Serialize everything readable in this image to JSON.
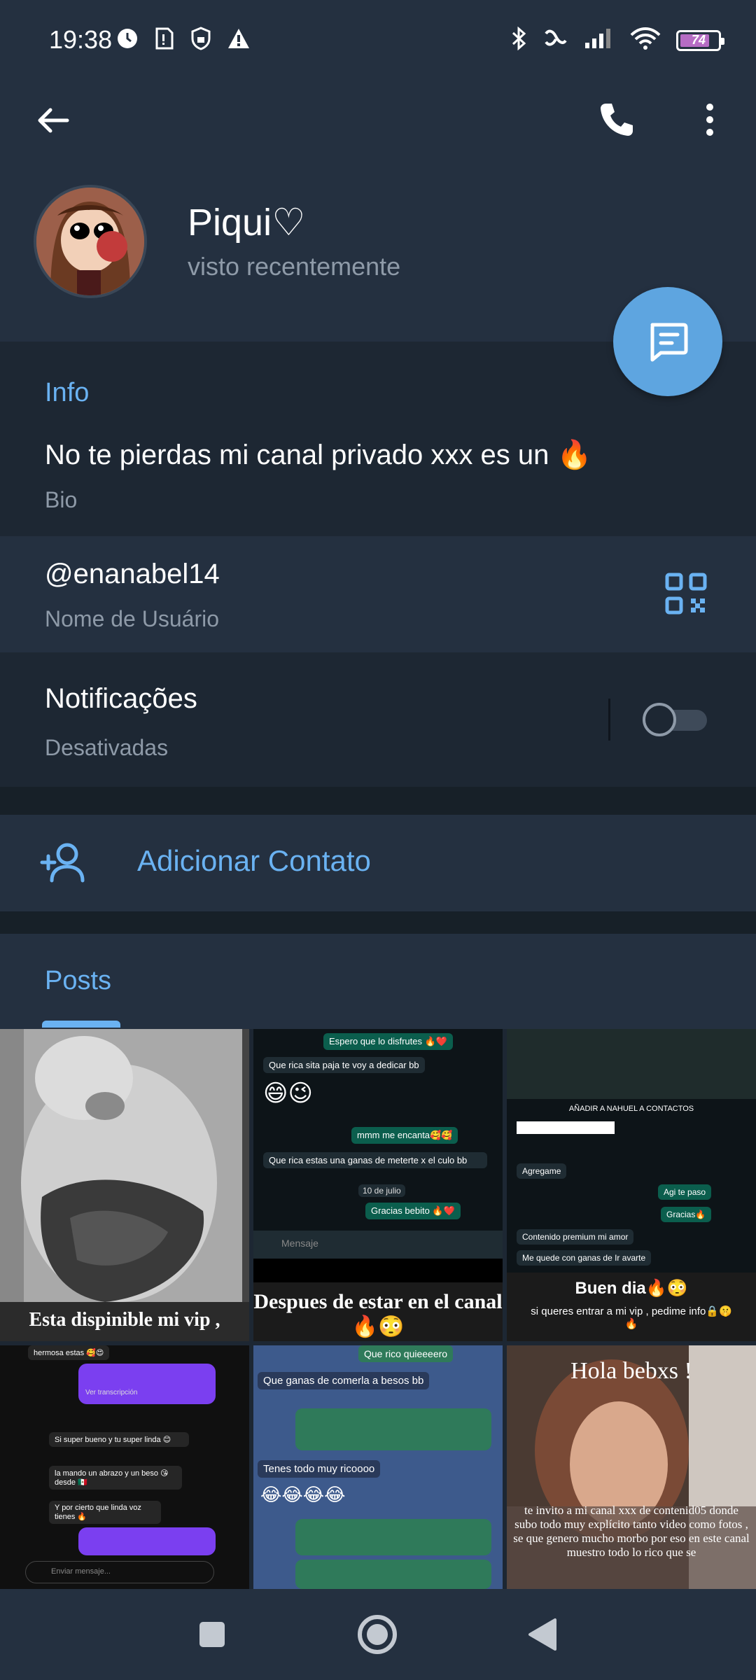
{
  "status_bar": {
    "time": "19:38",
    "battery": "74",
    "icons_left": [
      "clock-icon",
      "sim-icon",
      "vpn-icon",
      "warning-icon"
    ],
    "icons_right": [
      "bluetooth-icon",
      "link-icon",
      "signal-icon",
      "wifi-icon",
      "battery-icon"
    ]
  },
  "header": {
    "name": "Piqui♡",
    "status": "visto recentemente"
  },
  "info": {
    "section_title": "Info",
    "bio": "No te pierdas mi canal privado xxx es un 🔥",
    "bio_label": "Bio",
    "username": "@enanabel14",
    "username_label": "Nome de Usuário",
    "notifications": "Notificações",
    "notifications_state": "Desativadas"
  },
  "actions": {
    "add_contact": "Adicionar Contato"
  },
  "posts": {
    "tab_label": "Posts",
    "tile1_caption": "Esta dispinible mi vip ,",
    "tile2_caption": "Despues de estar en el canal 🔥😳",
    "tile2_chat": [
      "Espero que lo disfrutes 🔥❤️",
      "Que rica sita paja te voy a dedicar bb",
      "😄😉",
      "mmm me encanta🥰🥰",
      "Que rica estas una ganas de meterte x el culo bb",
      "10 de julio",
      "Gracias bebito 🔥❤️"
    ],
    "tile2_input": "Mensaje",
    "tile3_dialog": "AÑADIR A NAHUEL A CONTACTOS",
    "tile3_chat": [
      "Agregame",
      "Agi te paso",
      "Gracias🔥",
      "Contenido premium mi amor",
      "Me quede con ganas de Ir avarte"
    ],
    "tile3_caption": "Buen dia🔥😳",
    "tile3_sub": "si queres entrar a mi vip , pedime info🔒🤫🔥",
    "tile4_chat": [
      "hermosa estas 🥰😍",
      "Ver transcripción",
      "Si super bueno y tu super linda 😊",
      "la mando un abrazo y un beso 😘desde 🇲🇽",
      "Y por cierto que linda voz tienes 🔥"
    ],
    "tile4_input": "Enviar mensaje...",
    "tile5_chat": [
      "Que rico quieeeero",
      "Que ganas de comerla a besos bb",
      "Tenes todo muy ricoooo",
      "😂😂😂😂"
    ],
    "tile6_title": "Hola bebxs !",
    "tile6_text": "te invito a mi canal xxx de contenid05 donde subo todo muy explícito tanto video como fotos , se que genero mucho morbo por eso en este canal muestro todo lo rico que se"
  },
  "navbar": {
    "items": [
      "recents-button",
      "home-button",
      "back-button"
    ]
  },
  "colors": {
    "accent": "#6ab2f2",
    "background": "#1d2733",
    "header_bg": "#243040",
    "fab": "#5ea5e0"
  }
}
